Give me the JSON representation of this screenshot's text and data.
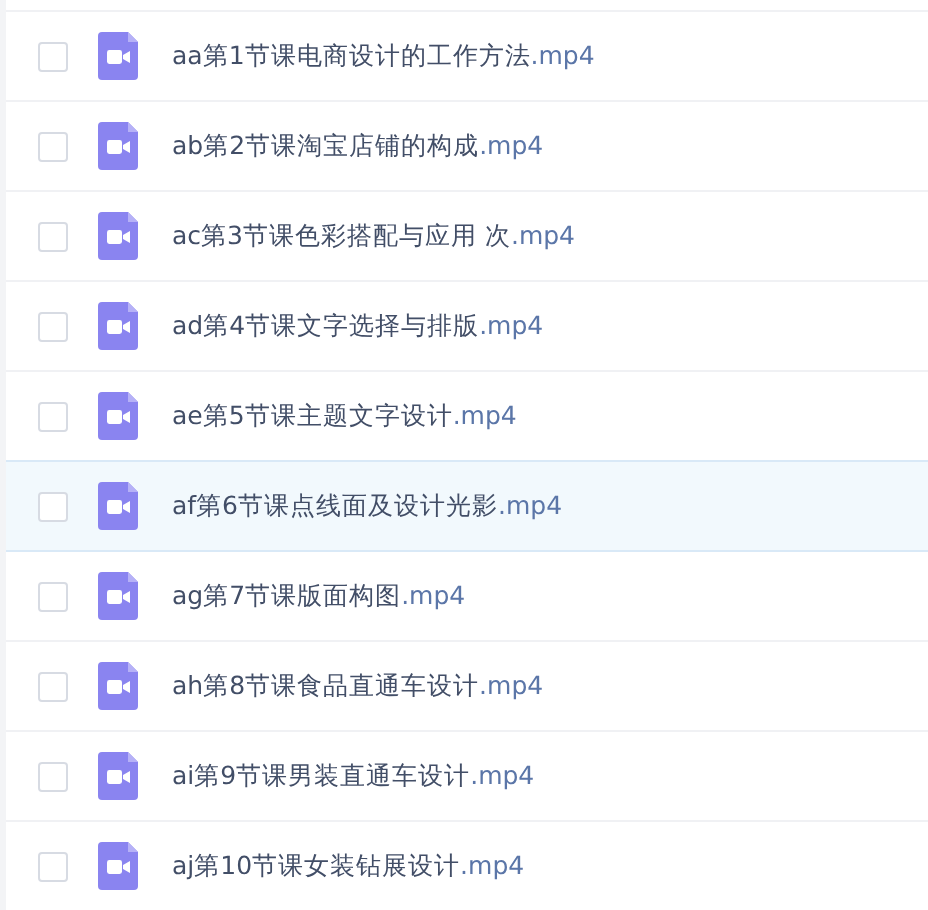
{
  "files": [
    {
      "name": "aa第1节课电商设计的工作方法",
      "extension": ".mp4",
      "checked": false,
      "highlighted": false
    },
    {
      "name": "ab第2节课淘宝店铺的构成",
      "extension": ".mp4",
      "checked": false,
      "highlighted": false
    },
    {
      "name": "ac第3节课色彩搭配与应用 次",
      "extension": ".mp4",
      "checked": false,
      "highlighted": false
    },
    {
      "name": "ad第4节课文字选择与排版",
      "extension": ".mp4",
      "checked": false,
      "highlighted": false
    },
    {
      "name": "ae第5节课主题文字设计",
      "extension": ".mp4",
      "checked": false,
      "highlighted": false
    },
    {
      "name": "af第6节课点线面及设计光影",
      "extension": ".mp4",
      "checked": false,
      "highlighted": true
    },
    {
      "name": "ag第7节课版面构图",
      "extension": ".mp4",
      "checked": false,
      "highlighted": false
    },
    {
      "name": "ah第8节课食品直通车设计",
      "extension": ".mp4",
      "checked": false,
      "highlighted": false
    },
    {
      "name": "ai第9节课男装直通车设计",
      "extension": ".mp4",
      "checked": false,
      "highlighted": false
    },
    {
      "name": "aj第10节课女装钻展设计",
      "extension": ".mp4",
      "checked": false,
      "highlighted": false
    }
  ]
}
